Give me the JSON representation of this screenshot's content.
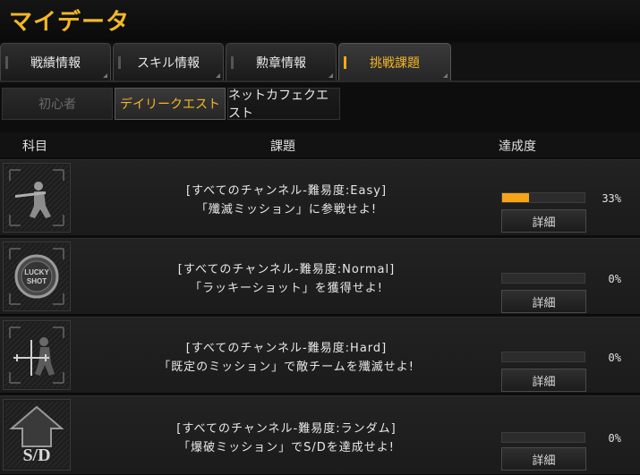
{
  "app": {
    "title": "マイデータ"
  },
  "tabs": [
    {
      "label": "戦績情報"
    },
    {
      "label": "スキル情報"
    },
    {
      "label": "勲章情報"
    },
    {
      "label": "挑戦課題",
      "active": true
    }
  ],
  "subtabs": [
    {
      "label": "初心者",
      "state": "disabled"
    },
    {
      "label": "デイリークエスト",
      "state": "selected"
    },
    {
      "label": "ネットカフェクエスト",
      "state": "normal"
    }
  ],
  "columns": {
    "subject": "科目",
    "task": "課題",
    "progress": "達成度"
  },
  "accent": "#f5a41a",
  "quests": [
    {
      "icon": "soldier-icon",
      "line1": "[すべてのチャンネル-難易度:Easy]",
      "line2": "「殲滅ミッション」に参戦せよ!",
      "progress": 33,
      "progress_label": "33%",
      "detail_label": "詳細"
    },
    {
      "icon": "lucky-shot-medal-icon",
      "icon_text": "LUCKY SHOT",
      "line1": "[すべてのチャンネル-難易度:Normal]",
      "line2": "「ラッキーショット」を獲得せよ!",
      "progress": 0,
      "progress_label": "0%",
      "detail_label": "詳細"
    },
    {
      "icon": "crosshair-soldier-icon",
      "line1": "[すべてのチャンネル-難易度:Hard]",
      "line2": "「既定のミッション」で敵チームを殲滅せよ!",
      "progress": 0,
      "progress_label": "0%",
      "detail_label": "詳細"
    },
    {
      "icon": "sd-bomb-icon",
      "icon_text": "S/D",
      "line1": "[すべてのチャンネル-難易度:ランダム]",
      "line2": "「爆破ミッション」でS/Dを達成せよ!",
      "progress": 0,
      "progress_label": "0%",
      "detail_label": "詳細"
    }
  ]
}
